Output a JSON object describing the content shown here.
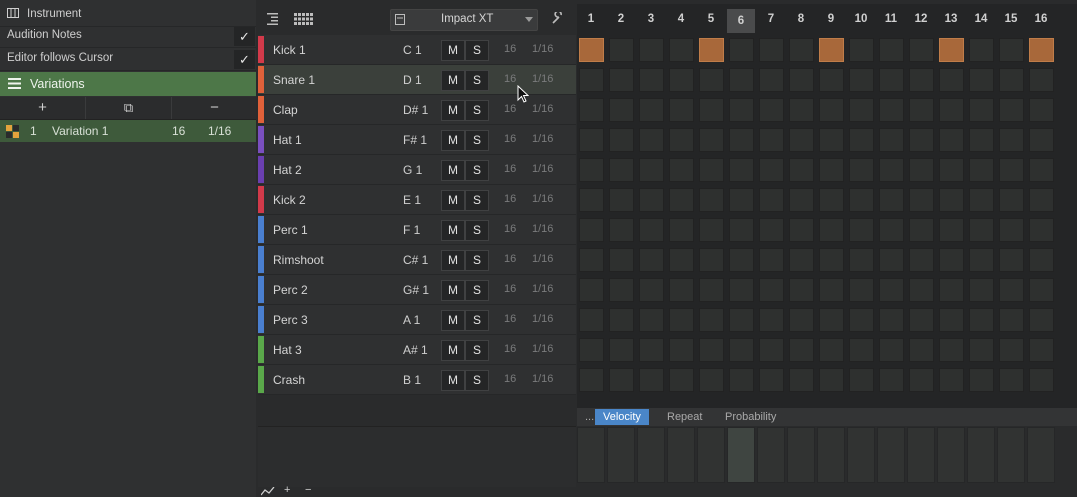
{
  "left_panel": {
    "instrument_label": "Instrument",
    "audition_notes_label": "Audition Notes",
    "editor_follows_label": "Editor follows Cursor",
    "check_glyph": "✓",
    "variations_label": "Variations",
    "add_glyph": "+",
    "duplicate_glyph": "⧉",
    "remove_glyph": "−",
    "variation": {
      "index": "1",
      "name": "Variation 1",
      "length": "16",
      "resolution": "1/16"
    }
  },
  "toolbar": {
    "instrument_name": "Impact XT"
  },
  "step_numbers": [
    "1",
    "2",
    "3",
    "4",
    "5",
    "6",
    "7",
    "8",
    "9",
    "10",
    "11",
    "12",
    "13",
    "14",
    "15",
    "16"
  ],
  "current_step": "6",
  "tracks": [
    {
      "name": "Kick 1",
      "note": "C 1",
      "m": "M",
      "s": "S",
      "len": "16",
      "res": "1/16",
      "color": "#d23a4a",
      "steps": [
        1,
        5,
        9,
        13,
        16
      ]
    },
    {
      "name": "Snare 1",
      "note": "D 1",
      "m": "M",
      "s": "S",
      "len": "16",
      "res": "1/16",
      "color": "#e0613a",
      "steps": []
    },
    {
      "name": "Clap",
      "note": "D# 1",
      "m": "M",
      "s": "S",
      "len": "16",
      "res": "1/16",
      "color": "#e0613a",
      "steps": []
    },
    {
      "name": "Hat 1",
      "note": "F# 1",
      "m": "M",
      "s": "S",
      "len": "16",
      "res": "1/16",
      "color": "#7a4fbf",
      "steps": []
    },
    {
      "name": "Hat 2",
      "note": "G 1",
      "m": "M",
      "s": "S",
      "len": "16",
      "res": "1/16",
      "color": "#6a3fb0",
      "steps": []
    },
    {
      "name": "Kick 2",
      "note": "E 1",
      "m": "M",
      "s": "S",
      "len": "16",
      "res": "1/16",
      "color": "#d23a4a",
      "steps": []
    },
    {
      "name": "Perc 1",
      "note": "F 1",
      "m": "M",
      "s": "S",
      "len": "16",
      "res": "1/16",
      "color": "#4a7fd0",
      "steps": []
    },
    {
      "name": "Rimshoot",
      "note": "C# 1",
      "m": "M",
      "s": "S",
      "len": "16",
      "res": "1/16",
      "color": "#4a7fd0",
      "steps": []
    },
    {
      "name": "Perc 2",
      "note": "G# 1",
      "m": "M",
      "s": "S",
      "len": "16",
      "res": "1/16",
      "color": "#4a7fd0",
      "steps": []
    },
    {
      "name": "Perc 3",
      "note": "A 1",
      "m": "M",
      "s": "S",
      "len": "16",
      "res": "1/16",
      "color": "#4a7fd0",
      "steps": []
    },
    {
      "name": "Hat 3",
      "note": "A# 1",
      "m": "M",
      "s": "S",
      "len": "16",
      "res": "1/16",
      "color": "#5aa84a",
      "steps": []
    },
    {
      "name": "Crash",
      "note": "B 1",
      "m": "M",
      "s": "S",
      "len": "16",
      "res": "1/16",
      "color": "#5aa84a",
      "steps": []
    }
  ],
  "bottom_tabs": {
    "more": "...",
    "velocity": "Velocity",
    "repeat": "Repeat",
    "probability": "Probability",
    "active": "Velocity"
  },
  "bottom_tools": {
    "add": "+",
    "remove": "−"
  }
}
